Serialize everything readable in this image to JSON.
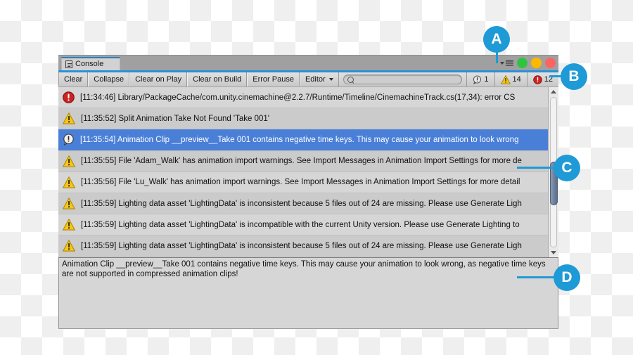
{
  "window": {
    "tab_label": "Console",
    "tab_icon": "console-icon",
    "menu_icon": "hamburger-menu-icon",
    "dots": [
      {
        "name": "green-dot",
        "color": "#2dc53f"
      },
      {
        "name": "yellow-dot",
        "color": "#fcb900"
      },
      {
        "name": "red-dot",
        "color": "#fc6463"
      }
    ]
  },
  "toolbar": {
    "clear_label": "Clear",
    "collapse_label": "Collapse",
    "clear_on_play_label": "Clear on Play",
    "clear_on_build_label": "Clear on Build",
    "error_pause_label": "Error Pause",
    "editor_label": "Editor",
    "search": {
      "value": "",
      "placeholder": ""
    },
    "counters": {
      "info": "1",
      "warning": "14",
      "error": "12"
    }
  },
  "log": {
    "rows": [
      {
        "type": "error",
        "selected": false,
        "text": "[11:34:46] Library/PackageCache/com.unity.cinemachine@2.2.7/Runtime/Timeline/CinemachineTrack.cs(17,34): error CS"
      },
      {
        "type": "warning",
        "selected": false,
        "text": "[11:35:52] Split Animation Take Not Found 'Take 001'"
      },
      {
        "type": "info",
        "selected": true,
        "text": "[11:35:54] Animation Clip __preview__Take 001 contains negative time keys. This may cause your animation to look wrong"
      },
      {
        "type": "warning",
        "selected": false,
        "text": "[11:35:55] File 'Adam_Walk' has animation import warnings. See Import Messages in Animation Import Settings for more de"
      },
      {
        "type": "warning",
        "selected": false,
        "text": "[11:35:56] File 'Lu_Walk' has animation import warnings. See Import Messages in Animation Import Settings for more detail"
      },
      {
        "type": "warning",
        "selected": false,
        "text": "[11:35:59] Lighting data asset 'LightingData' is inconsistent because 5 files out of 24 are missing.  Please use Generate Ligh"
      },
      {
        "type": "warning",
        "selected": false,
        "text": "[11:35:59] Lighting data asset 'LightingData' is incompatible with the current Unity version. Please use Generate Lighting to"
      },
      {
        "type": "warning",
        "selected": false,
        "text": "[11:35:59] Lighting data asset 'LightingData' is inconsistent because 5 files out of 24 are missing.  Please use Generate Ligh"
      }
    ],
    "scrollbar": {
      "up_arrow": "scroll-up-arrow-icon",
      "down_arrow": "scroll-down-arrow-icon"
    }
  },
  "detail": {
    "text": "Animation Clip __preview__Take 001 contains negative time keys. This may cause your animation to look wrong, as negative time keys are not supported in compressed animation clips!"
  },
  "callouts": [
    {
      "label": "A"
    },
    {
      "label": "B"
    },
    {
      "label": "C"
    },
    {
      "label": "D"
    }
  ],
  "colors": {
    "accent": "#1e9ad6",
    "selection": "#4a7fd8",
    "error": "#cc2222",
    "warning": "#f5c518",
    "tab_underline": "#2b7fc4"
  }
}
